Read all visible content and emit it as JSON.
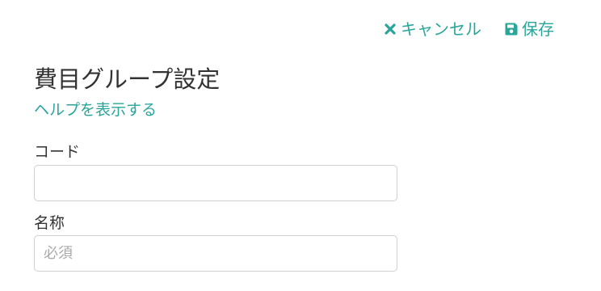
{
  "toolbar": {
    "cancel_label": "キャンセル",
    "cancel_icon": "close-icon",
    "save_label": "保存",
    "save_icon": "floppy-disk-icon"
  },
  "header": {
    "title": "費目グループ設定",
    "help_link": "ヘルプを表示する"
  },
  "form": {
    "code": {
      "label": "コード",
      "value": "",
      "placeholder": ""
    },
    "name": {
      "label": "名称",
      "value": "",
      "placeholder": "必須"
    }
  },
  "colors": {
    "accent": "#2aa59a",
    "text": "#333333",
    "border": "#d0d0d0",
    "placeholder": "#aaaaaa"
  }
}
